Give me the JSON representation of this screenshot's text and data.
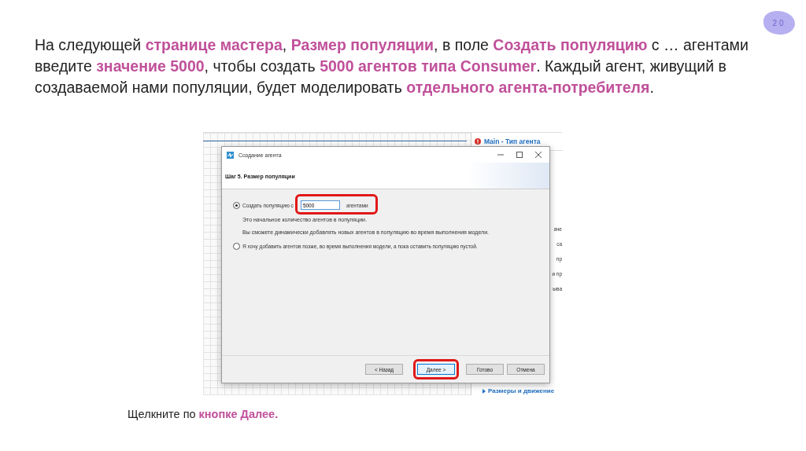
{
  "slide_number": "20",
  "heading": "На следующей **странице мастера**, **Размер популяции**, в поле **Создать популяцию** с … агентами введите **значение 5000**, чтобы создать **5000 агентов типа Consumer**. Каждый агент, живущий в создаваемой нами популяции, будет моделировать **отдельного агента-потребителя**.",
  "screenshot": {
    "panel_title": "Main - Тип агента",
    "panel_fragments": [
      "аче",
      "ca",
      "пр",
      "и пр",
      "ыва"
    ],
    "panel_bottom": "Размеры и движение",
    "dialog": {
      "title": "Создание агента",
      "step_title": "Шаг 5. Размер популяции",
      "options": [
        {
          "kind": "field",
          "selected": true,
          "label": "Создать популяцию с",
          "value": "5000",
          "suffix": "агентами",
          "highlighted": true,
          "notes": [
            "Это начальное количество агентов в популяции.",
            "Вы сможете динамически добавлять новых агентов в популяцию во время выполнения модели."
          ]
        },
        {
          "kind": "plain",
          "selected": false,
          "label": "Я хочу добавить агентов позже, во время выполнения модели, а пока оставить популяцию пустой."
        }
      ],
      "buttons": [
        {
          "label": "< Назад",
          "focused": false,
          "highlighted": false
        },
        {
          "label": "Далее >",
          "focused": true,
          "highlighted": true
        },
        {
          "label": "Готово",
          "focused": false,
          "highlighted": false
        },
        {
          "label": "Отмена",
          "focused": false,
          "highlighted": false
        }
      ]
    }
  },
  "footer": "Щелкните по **кнопке Далее.**"
}
